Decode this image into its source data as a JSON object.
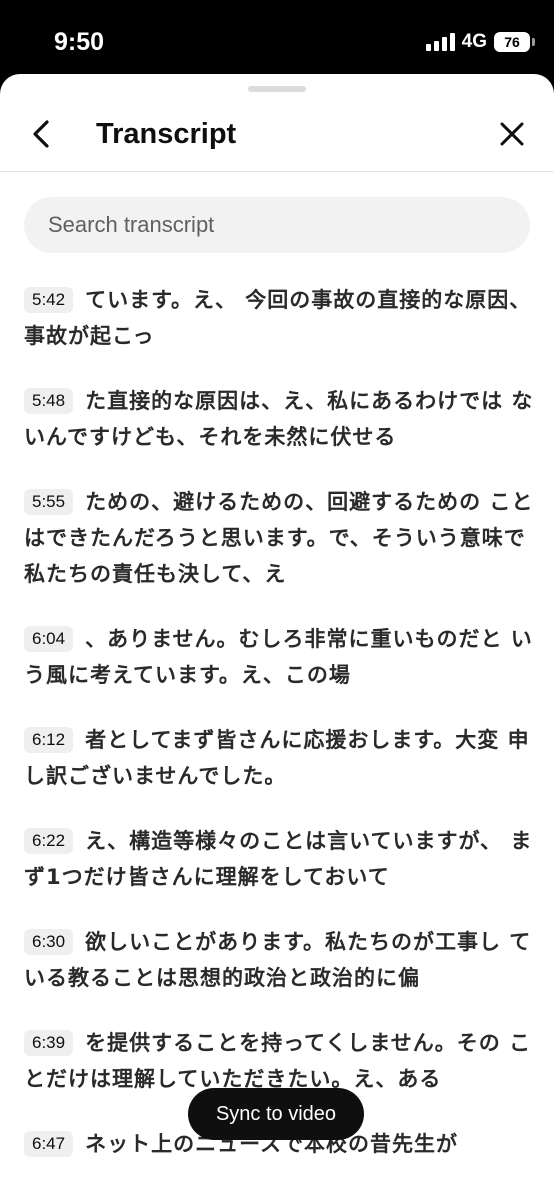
{
  "status": {
    "time": "9:50",
    "network": "4G",
    "battery": "76"
  },
  "header": {
    "title": "Transcript"
  },
  "search": {
    "placeholder": "Search transcript"
  },
  "segments": [
    {
      "time": "5:42",
      "text": "ています。え、 今回の事故の直接的な原因、事故が起こっ"
    },
    {
      "time": "5:48",
      "text": "た直接的な原因は、え、私にあるわけでは ないんですけども、それを未然に伏せる"
    },
    {
      "time": "5:55",
      "text": "ための、避けるための、回避するための ことはできたんだろうと思います。で、そういう意味で私たちの責任も決して、え"
    },
    {
      "time": "6:04",
      "text": "、ありません。むしろ非常に重いものだと いう風に考えています。え、この場"
    },
    {
      "time": "6:12",
      "text": "者としてまず皆さんに応援おします。大変 申し訳ございませんでした。"
    },
    {
      "time": "6:22",
      "text": "え、構造等様々のことは言いていますが、 まず1つだけ皆さんに理解をしておいて"
    },
    {
      "time": "6:30",
      "text": "欲しいことがあります。私たちのが工事し ている教ることは思想的政治と政治的に偏"
    },
    {
      "time": "6:39",
      "text": "を提供することを持ってくしません。その ことだけは理解していただきたい。え、ある"
    },
    {
      "time": "6:47",
      "text": "ネット上のニュースで本校の昔先生が"
    }
  ],
  "sync": {
    "label": "Sync to video"
  }
}
